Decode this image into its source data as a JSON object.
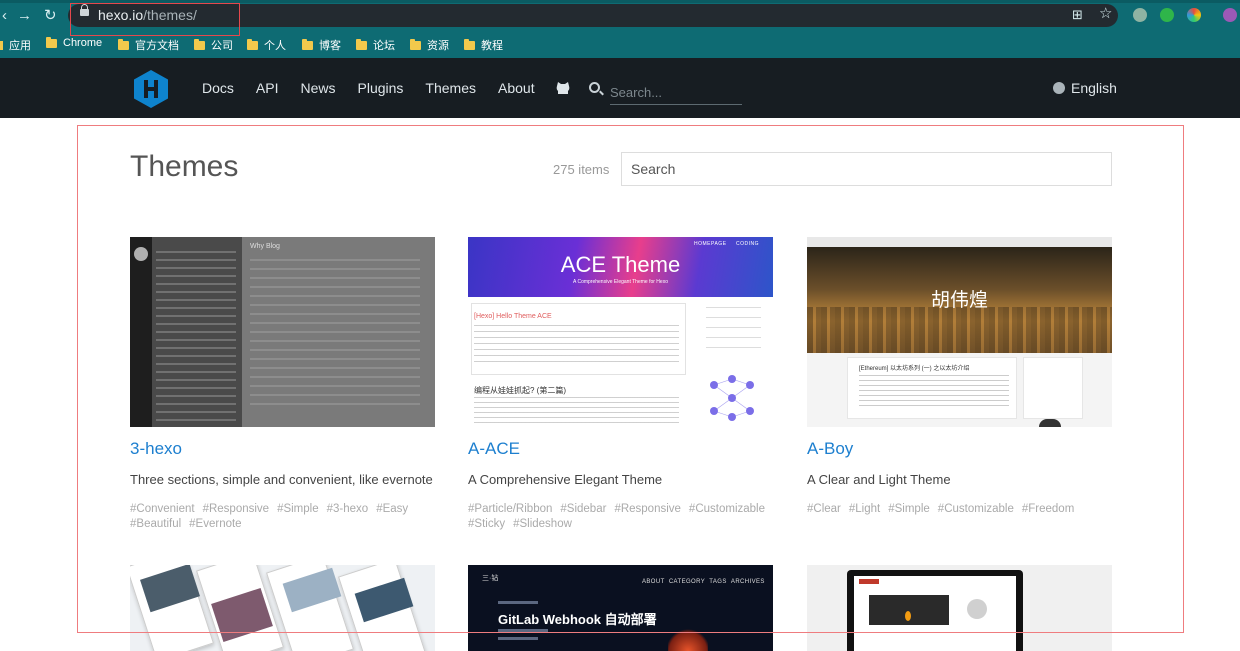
{
  "browser": {
    "url_host": "hexo.io",
    "url_path": "/themes/",
    "bookmarks": [
      "应用",
      "Chrome",
      "官方文档",
      "公司",
      "个人",
      "博客",
      "论坛",
      "资源",
      "教程"
    ]
  },
  "site": {
    "nav": [
      "Docs",
      "API",
      "News",
      "Plugins",
      "Themes",
      "About"
    ],
    "search_placeholder": "Search...",
    "language": "English"
  },
  "page": {
    "title": "Themes",
    "count": "275 items",
    "search_placeholder": "Search"
  },
  "themes": [
    {
      "name": "3-hexo",
      "desc": "Three sections, simple and convenient, like evernote",
      "tags": [
        "#Convenient",
        "#Responsive",
        "#Simple",
        "#3-hexo",
        "#Easy",
        "#Beautiful",
        "#Evernote"
      ],
      "thumb_text": "Why Blog"
    },
    {
      "name": "A-ACE",
      "desc": "A Comprehensive Elegant Theme",
      "tags": [
        "#Particle/Ribbon",
        "#Sidebar",
        "#Responsive",
        "#Customizable",
        "#Sticky",
        "#Slideshow"
      ],
      "thumb_title": "ACE Theme",
      "thumb_sub": "A Comprehensive Elegant Theme for Hexo",
      "thumb_nav": [
        "HOMEPAGE",
        "CODING"
      ],
      "thumb_post": "[Hexo] Hello Theme ACE",
      "thumb_post2": "编程从娃娃抓起? (第二篇)"
    },
    {
      "name": "A-Boy",
      "desc": "A Clear and Light Theme",
      "tags": [
        "#Clear",
        "#Light",
        "#Simple",
        "#Customizable",
        "#Freedom"
      ],
      "thumb_title": "胡伟煌",
      "thumb_post": "[Ethereum] 以太坊系列 (一) 之以太坊介绍"
    },
    {
      "thumb_nav": [
        "ABOUT",
        "CATEGORY",
        "TAGS",
        "ARCHIVES"
      ],
      "thumb_brand": "三·钻",
      "thumb_title": "GitLab Webhook 自动部署"
    }
  ],
  "colors": {
    "header_bg": "#171d22",
    "browser_bg": "#0e6b73",
    "link_blue": "#1d7fcf",
    "hexo_blue": "#0e83cd"
  }
}
